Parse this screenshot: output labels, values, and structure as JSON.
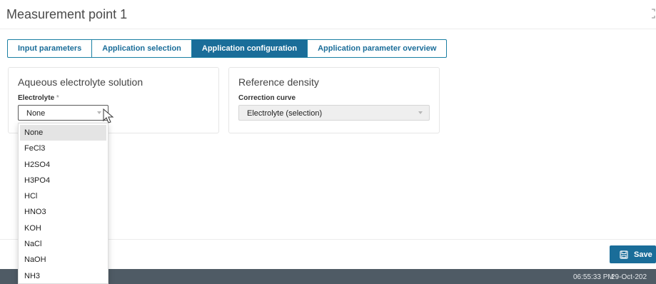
{
  "header": {
    "title": "Measurement point 1",
    "expand_icon": "expand-icon"
  },
  "tabs": [
    {
      "label": "Input parameters",
      "active": false
    },
    {
      "label": "Application selection",
      "active": false
    },
    {
      "label": "Application configuration",
      "active": true
    },
    {
      "label": "Application parameter overview",
      "active": false
    }
  ],
  "cards": {
    "electrolyte": {
      "title": "Aqueous electrolyte solution",
      "label": "Electrolyte",
      "required_mark": "*",
      "value": "None"
    },
    "density": {
      "title": "Reference density",
      "label": "Correction curve",
      "value": "Electrolyte (selection)"
    }
  },
  "dropdown": {
    "selected": "None",
    "options": [
      "None",
      "FeCl3",
      "H2SO4",
      "H3PO4",
      "HCl",
      "HNO3",
      "KOH",
      "NaCl",
      "NaOH",
      "NH3"
    ]
  },
  "footer": {
    "save_label": "Save",
    "save_icon": "floppy-disk-icon"
  },
  "status": {
    "time": "06:55:33 PM",
    "date": "29-Oct-202"
  },
  "colors": {
    "accent": "#1a6d99",
    "status_bar": "#4f5b65"
  }
}
